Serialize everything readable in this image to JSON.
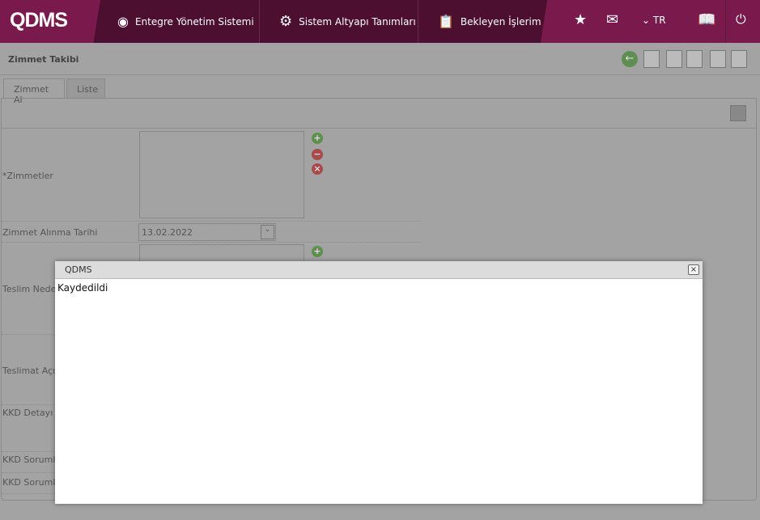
{
  "header": {
    "logo": "QDMS",
    "nav": [
      "Entegre Yönetim Sistemi",
      "Sistem Altyapı Tanımları",
      "Bekleyen İşlerim"
    ],
    "language": "TR"
  },
  "page": {
    "title": "Zimmet Takibi",
    "tabs": [
      "Zimmet Al",
      "Liste"
    ]
  },
  "form": {
    "labels": [
      "*Zimmetler",
      "Zimmet Alınma Tarihi",
      "Teslim Neden",
      "Teslimat Açıkl",
      "KKD Detayı",
      "KKD Sorumlu",
      "KKD Sorumlu"
    ],
    "date_value": "13.02.2022"
  },
  "dialog": {
    "title": "QDMS",
    "message": "Kaydedildi",
    "close": "×"
  }
}
